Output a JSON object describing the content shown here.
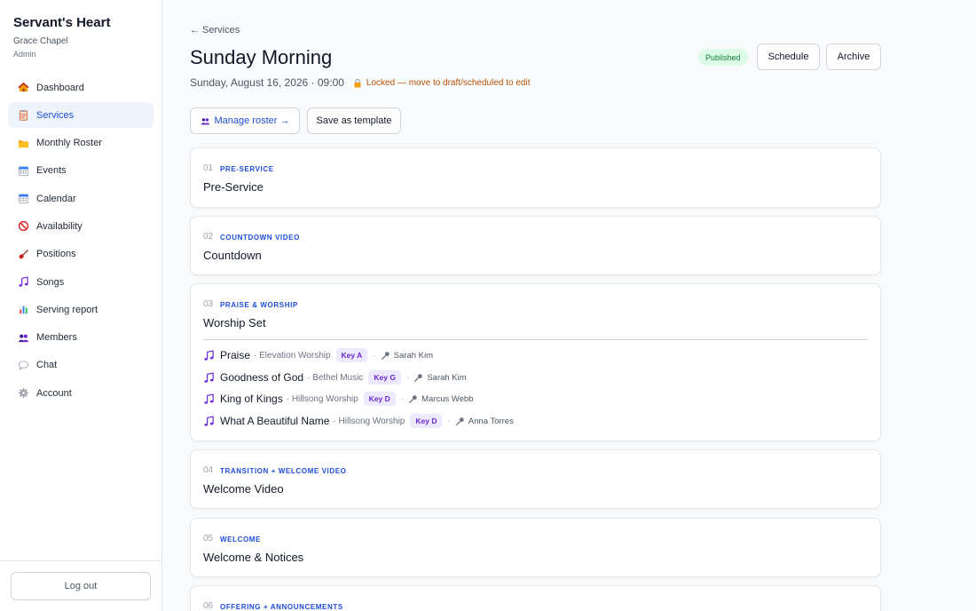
{
  "sidebar": {
    "brand": "Servant's Heart",
    "church": "Grace Chapel",
    "role": "Admin",
    "items": [
      {
        "label": "Dashboard",
        "icon": "house-icon"
      },
      {
        "label": "Services",
        "icon": "clipboard-icon",
        "active": true
      },
      {
        "label": "Monthly Roster",
        "icon": "folder-icon"
      },
      {
        "label": "Events",
        "icon": "calendar-icon"
      },
      {
        "label": "Calendar",
        "icon": "calendar-icon"
      },
      {
        "label": "Availability",
        "icon": "prohibited-icon"
      },
      {
        "label": "Positions",
        "icon": "guitar-icon"
      },
      {
        "label": "Songs",
        "icon": "music-note-icon"
      },
      {
        "label": "Serving report",
        "icon": "bar-chart-icon"
      },
      {
        "label": "Members",
        "icon": "people-icon"
      },
      {
        "label": "Chat",
        "icon": "speech-bubble-icon"
      },
      {
        "label": "Account",
        "icon": "gear-icon"
      }
    ],
    "logout": "Log out"
  },
  "header": {
    "back": "← Services",
    "title": "Sunday Morning",
    "datetime": "Sunday, August 16, 2026 · 09:00",
    "lock_note": "Locked — move to draft/scheduled to edit",
    "status": "Published",
    "schedule": "Schedule",
    "archive": "Archive",
    "manage_roster": "Manage roster →",
    "save_template": "Save as template"
  },
  "items": [
    {
      "num": "01",
      "category": "PRE-SERVICE",
      "name": "Pre-Service"
    },
    {
      "num": "02",
      "category": "COUNTDOWN VIDEO",
      "name": "Countdown"
    },
    {
      "num": "03",
      "category": "PRAISE & WORSHIP",
      "name": "Worship Set",
      "songs": [
        {
          "title": "Praise",
          "artist": "· Elevation Worship",
          "key": "Key A",
          "singer": "Sarah Kim"
        },
        {
          "title": "Goodness of God",
          "artist": "· Bethel Music",
          "key": "Key G",
          "singer": "Sarah Kim"
        },
        {
          "title": "King of Kings",
          "artist": "· Hillsong Worship",
          "key": "Key D",
          "singer": "Marcus Webb"
        },
        {
          "title": "What A Beautiful Name",
          "artist": "· Hillsong Worship",
          "key": "Key D",
          "singer": "Anna Torres"
        }
      ]
    },
    {
      "num": "04",
      "category": "TRANSITION + WELCOME VIDEO",
      "name": "Welcome Video"
    },
    {
      "num": "05",
      "category": "WELCOME",
      "name": "Welcome & Notices"
    },
    {
      "num": "06",
      "category": "OFFERING + ANNOUNCEMENTS",
      "name": ""
    }
  ],
  "colors": {
    "accent": "#1d4ed8",
    "published_bg": "#dcfce7",
    "published_text": "#15803d",
    "key_bg": "#ede9fe",
    "key_text": "#6d28d9",
    "lock_text": "#b45309"
  }
}
